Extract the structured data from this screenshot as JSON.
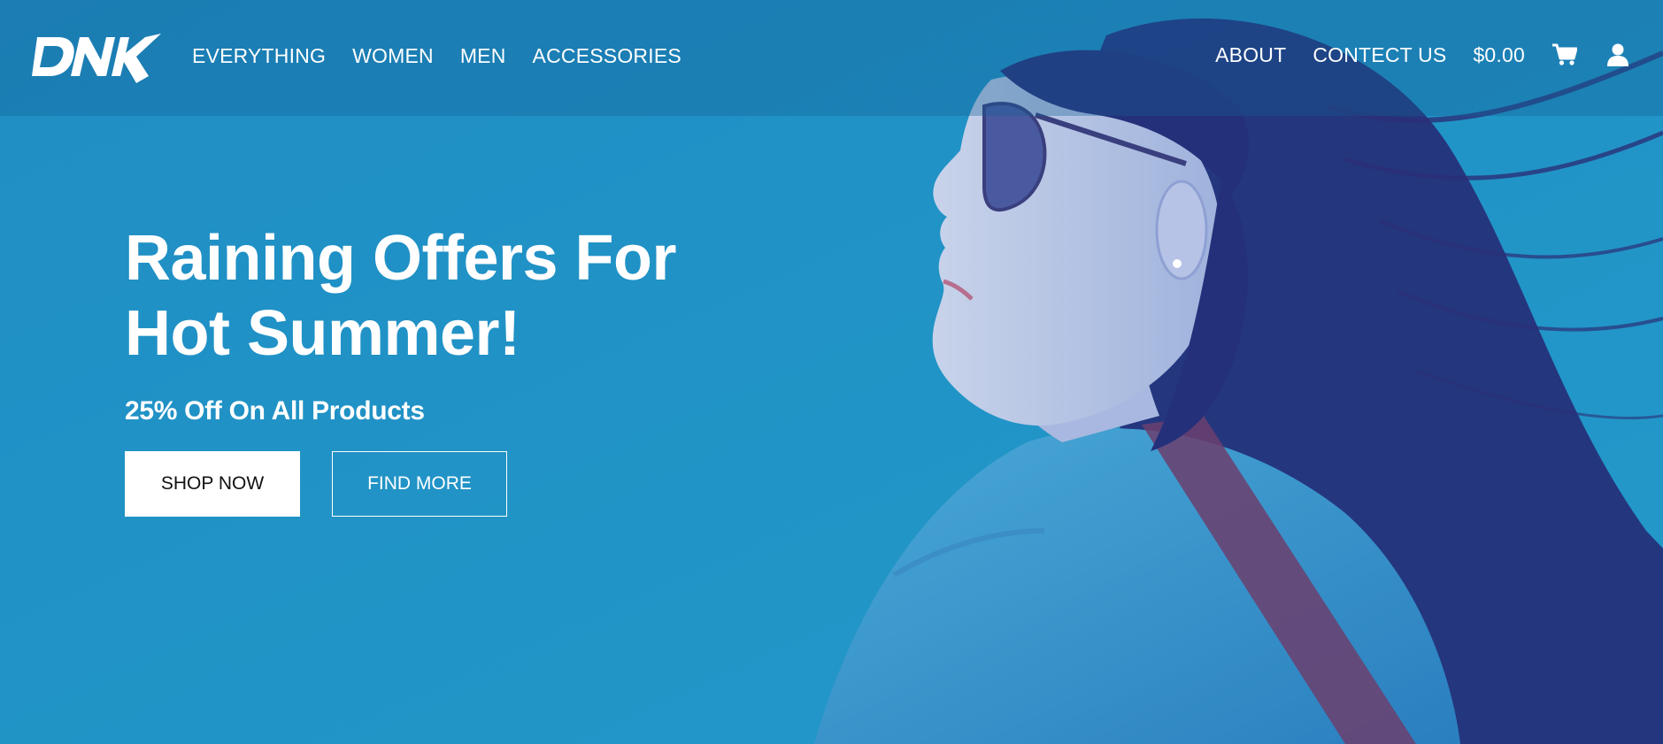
{
  "brand": {
    "logo_text": "DNK"
  },
  "nav": {
    "left": [
      "EVERYTHING",
      "WOMEN",
      "MEN",
      "ACCESSORIES"
    ],
    "about": "ABOUT",
    "contact": "CONTECT US",
    "cart_total": "$0.00",
    "cart_icon": "cart-icon",
    "account_icon": "user-icon"
  },
  "hero": {
    "title_line1": "Raining Offers For",
    "title_line2": "Hot Summer!",
    "subtitle": "25% Off On All Products",
    "shop_button": "SHOP NOW",
    "find_button": "FIND MORE"
  },
  "colors": {
    "background": "#1e92c7",
    "overlay": "#2a3d8f",
    "text": "#ffffff"
  }
}
